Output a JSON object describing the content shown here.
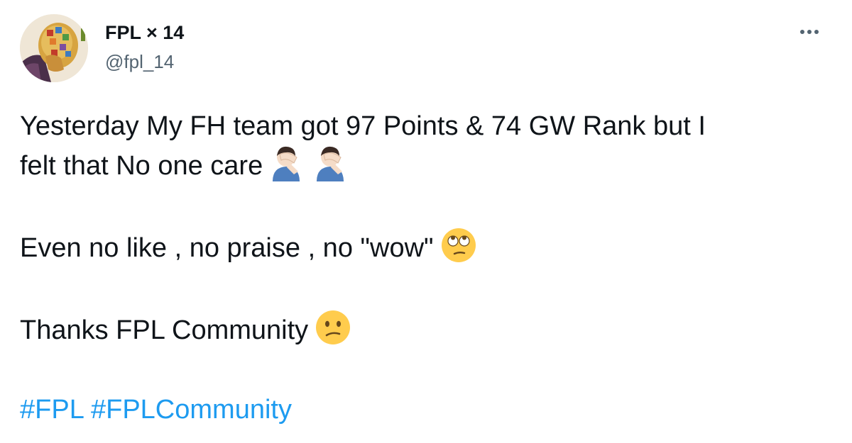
{
  "author": {
    "display_name": "FPL × 14",
    "handle": "@fpl_14"
  },
  "menu": {
    "icon": "more-horizontal-icon"
  },
  "tweet": {
    "line1": "Yesterday My FH team got 97 Points & 74 GW Rank but I",
    "line2": "felt that No one care",
    "line3": "Even no like , no praise , no \"wow\"",
    "line4": "Thanks FPL Community",
    "hashtag1": "#FPL",
    "hashtag2": "#FPLCommunity",
    "emojis": {
      "facepalm": "man-facepalming-emoji",
      "eyeroll": "face-with-rolling-eyes-emoji",
      "confused": "confused-face-emoji"
    }
  },
  "colors": {
    "text": "#0f1419",
    "secondary": "#536471",
    "link": "#1d9bf0",
    "emoji_yellow": "#ffcc4d"
  }
}
